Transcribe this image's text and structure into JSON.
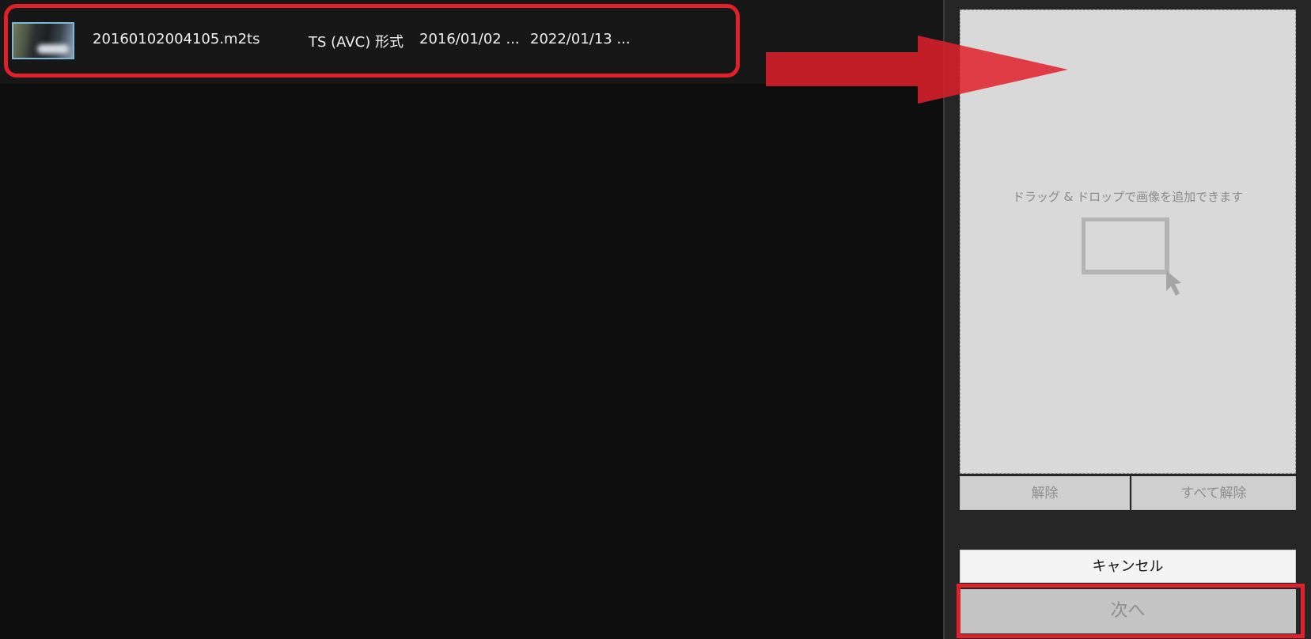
{
  "file_list": {
    "rows": [
      {
        "thumbnail_icon": "video-thumbnail",
        "filename": "20160102004105.m2ts",
        "format": "TS (AVC) 形式",
        "date1": "2016/01/02 ...",
        "date2": "2022/01/13 ..."
      }
    ]
  },
  "drop_zone": {
    "hint": "ドラッグ & ドロップで画像を追加できます",
    "icon": "drag-drop-icon"
  },
  "buttons": {
    "remove": "解除",
    "remove_all": "すべて解除",
    "cancel": "キャンセル",
    "next": "次へ"
  },
  "annotations": {
    "highlight_color": "#e0202a",
    "arrow_icon": "right-arrow-icon"
  }
}
